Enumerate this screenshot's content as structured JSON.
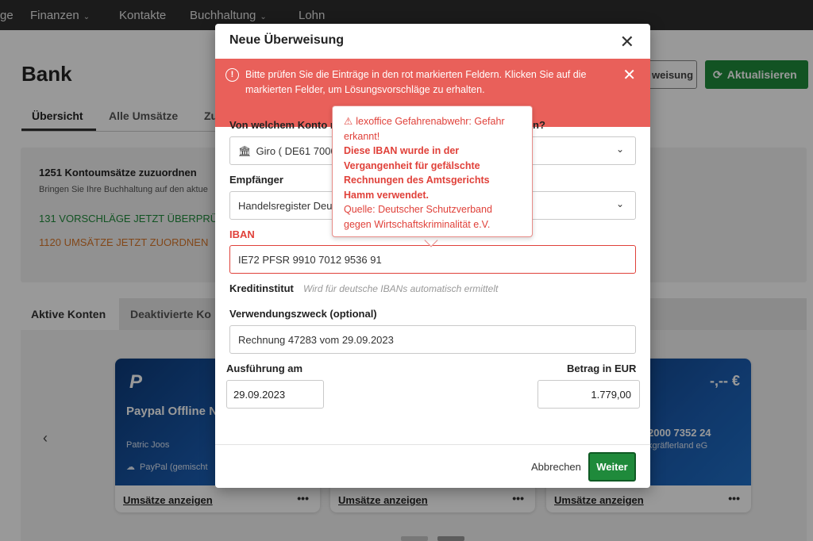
{
  "nav": {
    "partial_left": "ge",
    "items": [
      {
        "label": "Finanzen",
        "has_dropdown": true
      },
      {
        "label": "Kontakte",
        "has_dropdown": false
      },
      {
        "label": "Buchhaltung",
        "has_dropdown": true
      },
      {
        "label": "Lohn",
        "has_dropdown": false
      }
    ]
  },
  "page": {
    "title": "Bank",
    "tabs": [
      "Übersicht",
      "Alle Umsätze",
      "Zu"
    ],
    "btn_partial_label": "weisung",
    "refresh_label": "Aktualisieren"
  },
  "assign": {
    "title": "1251 Kontoumsätze zuzuordnen",
    "subtitle": "Bringen Sie Ihre Buchhaltung auf den aktue",
    "link_suggestions": "131 VORSCHLÄGE JETZT ÜBERPRÜFEN",
    "link_assign": "1120 UMSÄTZE JETZT ZUORDNEN"
  },
  "accounts": {
    "tab_active": "Aktive Konten",
    "tab_inactive": "Deaktivierte Ko",
    "cards": [
      {
        "logo": "P",
        "name": "Paypal Offline N",
        "owner": "Patric Joos",
        "type": "PayPal (gemischt",
        "link": "Umsätze anzeigen",
        "more": "•••"
      },
      {
        "link": "Umsätze anzeigen",
        "more": "•••"
      },
      {
        "balance": "-,-- €",
        "iban": "2000 7352 24",
        "bank": "kgräflerland eG",
        "link": "Umsätze anzeigen",
        "more": "•••"
      }
    ]
  },
  "modal": {
    "title": "Neue Überweisung",
    "alert": "Bitte prüfen Sie die Einträge in den rot markierten Feldern. Klicken Sie auf die markierten Felder, um Lösungsvorschläge zu erhalten.",
    "from_label": "Von welchem Konto m",
    "from_label_end": "n?",
    "from_value": "Giro ( DE61 7000",
    "recipient_label": "Empfänger",
    "recipient_value": "Handelsregister Deut",
    "iban_label": "IBAN",
    "iban_value": "IE72 PFSR 9910 7012 9536 91",
    "bank_label": "Kreditinstitut",
    "bank_hint": "Wird für deutsche IBANs automatisch ermittelt",
    "purpose_label": "Verwendungszweck (optional)",
    "purpose_value": "Rechnung 47283 vom 29.09.2023",
    "date_label": "Ausführung am",
    "date_value": "29.09.2023",
    "amount_label": "Betrag in EUR",
    "amount_value": "1.779,00",
    "cancel_label": "Abbrechen",
    "next_label": "Weiter"
  },
  "warning": {
    "heading": "lexoffice Gefahrenabwehr: Gefahr erkannt!",
    "body": "Diese IBAN wurde in der Vergangenheit für gefälschte Rechnungen des Amtsgerichts Hamm verwendet.",
    "source": "Quelle: Deutscher Schutzverband gegen Wirtschaftskriminalität e.V."
  },
  "colors": {
    "primary_green": "#1f8a3b",
    "error_red": "#e0413a",
    "alert_bg": "#e9605a",
    "nav_bg": "#2d2d2d",
    "card_blue": "#1a5cb0"
  }
}
